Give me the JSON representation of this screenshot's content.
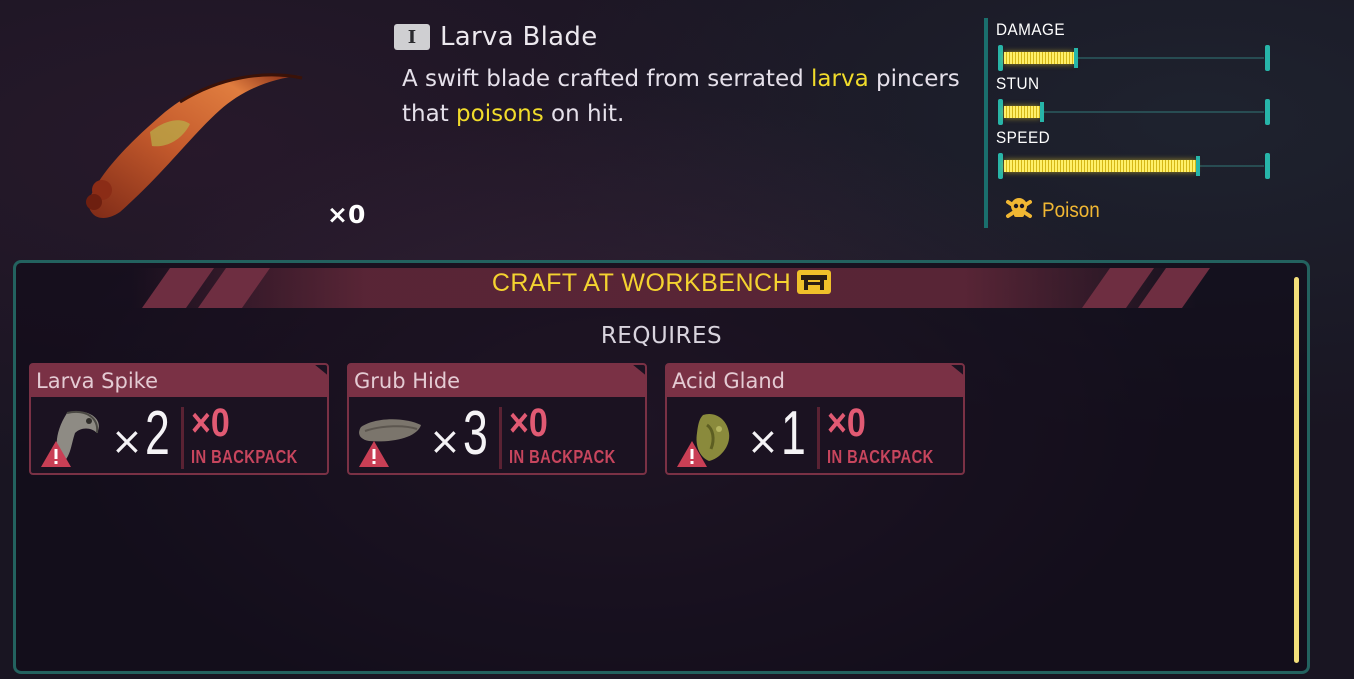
{
  "item": {
    "tier": "I",
    "name": "Larva Blade",
    "description": {
      "part1": "A swift blade crafted from serrated ",
      "keyword1": "larva",
      "part2": " pincers that ",
      "keyword2": "poisons",
      "part3": " on hit."
    },
    "owned": "×0",
    "icon": "larva-blade-icon"
  },
  "stats": {
    "items": [
      {
        "label": "DAMAGE",
        "level": 0.27
      },
      {
        "label": "STUN",
        "level": 0.14
      },
      {
        "label": "SPEED",
        "level": 0.74
      }
    ],
    "effect": {
      "label": "Poison",
      "icon": "poison-skull-icon"
    }
  },
  "craft": {
    "title": "CRAFT AT WORKBENCH",
    "station_icon": "workbench-icon",
    "requires_label": "REQUIRES",
    "ingredients": [
      {
        "name": "Larva Spike",
        "need_x": "×",
        "need_n": "2",
        "have": "×0",
        "have_label": "IN BACKPACK",
        "icon": "larva-spike-icon"
      },
      {
        "name": "Grub Hide",
        "need_x": "×",
        "need_n": "3",
        "have": "×0",
        "have_label": "IN BACKPACK",
        "icon": "grub-hide-icon"
      },
      {
        "name": "Acid Gland",
        "need_x": "×",
        "need_n": "1",
        "have": "×0",
        "have_label": "IN BACKPACK",
        "icon": "acid-gland-icon"
      }
    ]
  },
  "colors": {
    "accent_teal": "#27b5a9",
    "keyword_yellow": "#f1dc2b",
    "warning_red": "#e15a73",
    "poison_orange": "#f0b733"
  }
}
